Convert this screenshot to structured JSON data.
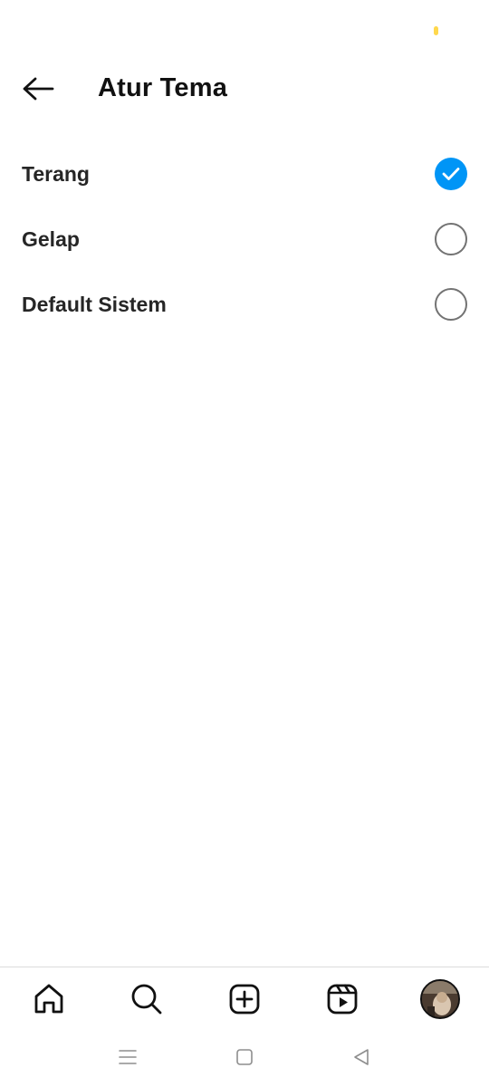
{
  "header": {
    "back_icon": "arrow-left-icon",
    "title": "Atur Tema"
  },
  "theme_options": [
    {
      "label": "Terang",
      "selected": true
    },
    {
      "label": "Gelap",
      "selected": false
    },
    {
      "label": "Default Sistem",
      "selected": false
    }
  ],
  "bottom_nav": {
    "items": [
      "home-icon",
      "search-icon",
      "create-post-icon",
      "reels-icon",
      "profile-avatar"
    ]
  },
  "system_nav": {
    "items": [
      "recent-apps-icon",
      "home-square-icon",
      "back-triangle-icon"
    ]
  },
  "colors": {
    "accent": "#0095f6",
    "text": "#262626",
    "radio_border": "#737373",
    "divider": "#dbdbdb"
  }
}
